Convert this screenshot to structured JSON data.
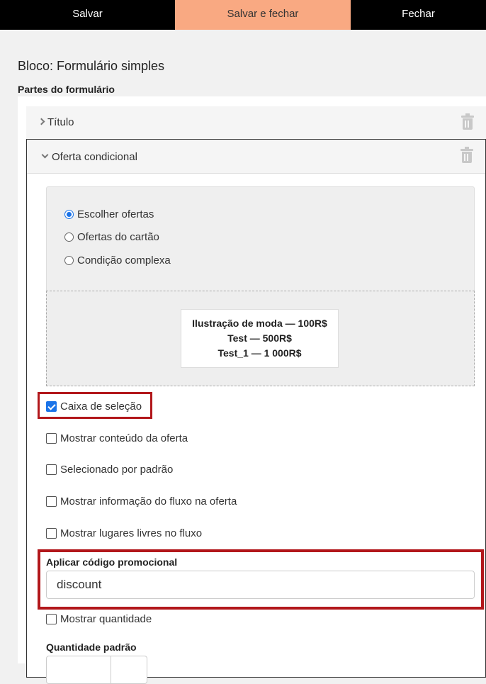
{
  "toolbar": {
    "save_label": "Salvar",
    "save_close_label": "Salvar e fechar",
    "close_label": "Fechar"
  },
  "page": {
    "block_title": "Bloco: Formulário simples",
    "parts_label": "Partes do formulário"
  },
  "parts": [
    {
      "name": "Título",
      "state": "collapsed",
      "icon": "chevron-right-icon"
    },
    {
      "name": "Oferta condicional",
      "state": "expanded",
      "icon": "chevron-down-icon"
    }
  ],
  "offer_mode": {
    "options": [
      "Escolher ofertas",
      "Ofertas do cartão",
      "Condição complexa"
    ],
    "selected": "Escolher ofertas"
  },
  "offers": [
    "Ilustração de moda — 100R$",
    "Test — 500R$",
    "Test_1 — 1 000R$"
  ],
  "options": [
    {
      "label": "Caixa de seleção",
      "checked": true
    },
    {
      "label": "Mostrar conteúdo da oferta",
      "checked": false
    },
    {
      "label": "Selecionado por padrão",
      "checked": false
    },
    {
      "label": "Mostrar informação do fluxo na oferta",
      "checked": false
    },
    {
      "label": "Mostrar lugares livres no fluxo",
      "checked": false
    }
  ],
  "promo": {
    "label": "Aplicar código promocional",
    "value": "discount"
  },
  "quantity": {
    "show_label": "Mostrar quantidade",
    "show_checked": false,
    "default_label": "Quantidade padrão"
  },
  "colors": {
    "accent": "#f9a982",
    "toolbar_bg": "#000000",
    "highlight": "#b2171b",
    "checkbox_blue": "#1a73e8"
  }
}
